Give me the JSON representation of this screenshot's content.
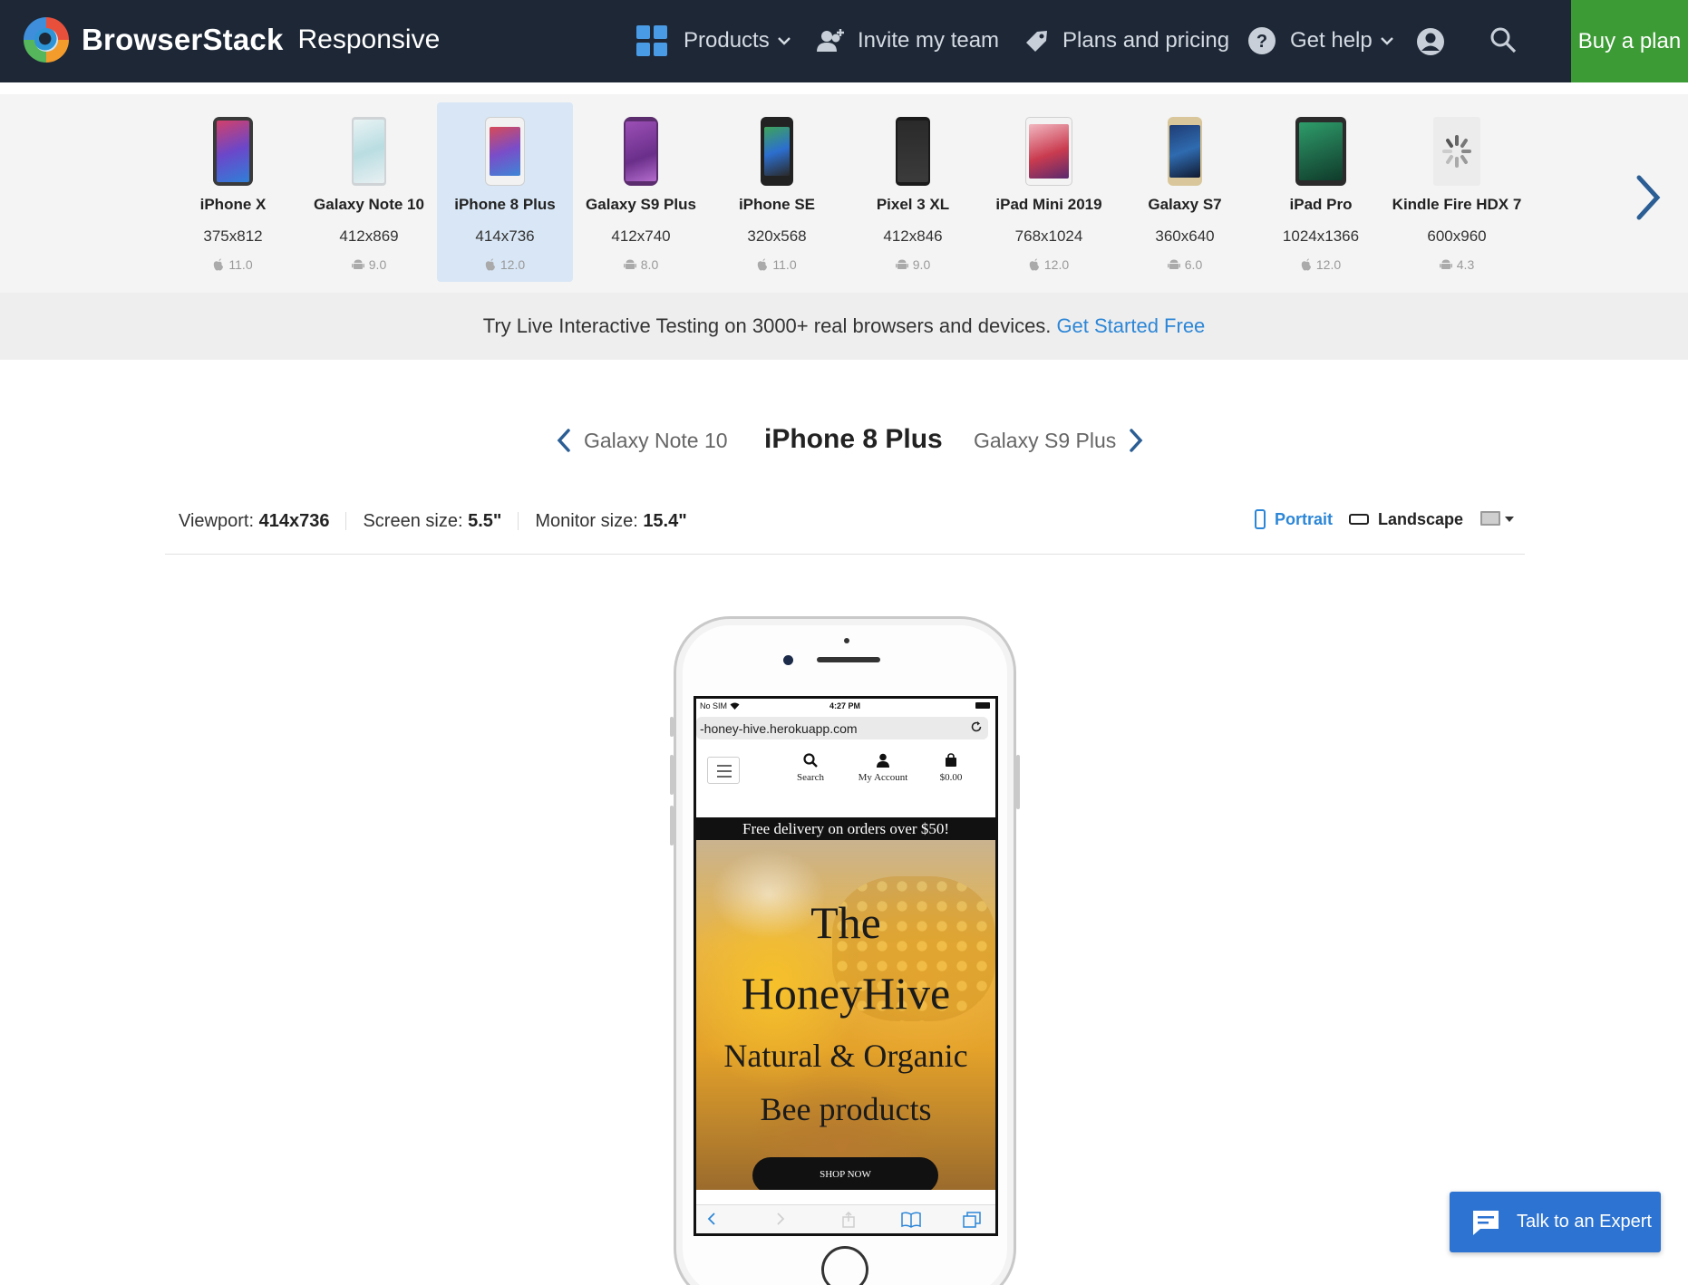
{
  "header": {
    "brand_name": "BrowserStack",
    "brand_product": "Responsive",
    "nav": {
      "products": "Products",
      "invite": "Invite my team",
      "plans": "Plans and pricing",
      "help": "Get help"
    },
    "buy_label": "Buy a plan"
  },
  "devices": [
    {
      "name": "iPhone X",
      "res": "375x812",
      "os": "apple",
      "version": "11.0"
    },
    {
      "name": "Galaxy Note 10",
      "res": "412x869",
      "os": "android",
      "version": "9.0"
    },
    {
      "name": "iPhone 8 Plus",
      "res": "414x736",
      "os": "apple",
      "version": "12.0",
      "selected": true
    },
    {
      "name": "Galaxy S9 Plus",
      "res": "412x740",
      "os": "android",
      "version": "8.0"
    },
    {
      "name": "iPhone SE",
      "res": "320x568",
      "os": "apple",
      "version": "11.0"
    },
    {
      "name": "Pixel 3 XL",
      "res": "412x846",
      "os": "android",
      "version": "9.0"
    },
    {
      "name": "iPad Mini 2019",
      "res": "768x1024",
      "os": "apple",
      "version": "12.0"
    },
    {
      "name": "Galaxy S7",
      "res": "360x640",
      "os": "android",
      "version": "6.0"
    },
    {
      "name": "iPad Pro",
      "res": "1024x1366",
      "os": "apple",
      "version": "12.0"
    },
    {
      "name": "Kindle Fire HDX 7",
      "res": "600x960",
      "os": "android",
      "version": "4.3"
    }
  ],
  "promo": {
    "text": "Try Live Interactive Testing on 3000+ real browsers and devices.",
    "link": "Get Started Free"
  },
  "switcher": {
    "prev": "Galaxy Note 10",
    "current": "iPhone 8 Plus",
    "next": "Galaxy S9 Plus"
  },
  "info": {
    "viewport_label": "Viewport:",
    "viewport_value": "414x736",
    "screen_label": "Screen size:",
    "screen_value": "5.5\"",
    "monitor_label": "Monitor size:",
    "monitor_value": "15.4\""
  },
  "orientation": {
    "portrait": "Portrait",
    "landscape": "Landscape",
    "active": "portrait"
  },
  "phone_screen": {
    "carrier": "No SIM",
    "time": "4:27 PM",
    "url": "-honey-hive.herokuapp.com",
    "nav_search": "Search",
    "nav_account": "My Account",
    "nav_cart": "$0.00",
    "delivery": "Free delivery on orders over $50!",
    "hero_line1": "The",
    "hero_line2": "HoneyHive",
    "hero_line3": "Natural & Organic",
    "hero_line4": "Bee products",
    "shop_now": "SHOP NOW"
  },
  "expert_label": "Talk to an Expert",
  "colors": {
    "nav_bg": "#1d2736",
    "buy_green": "#3c9b35",
    "link_blue": "#2c86d7",
    "selected_device_bg": "#d8e6f5",
    "expert_blue": "#2c73d2"
  }
}
